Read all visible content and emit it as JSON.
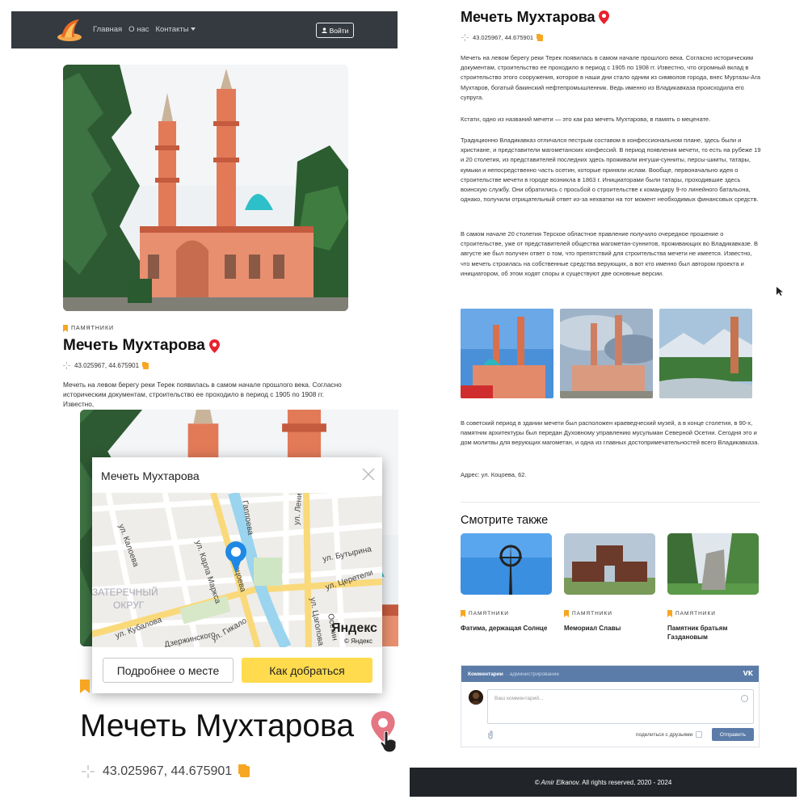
{
  "nav": {
    "links": [
      "Главная",
      "О нас",
      "Контакты"
    ],
    "login": "Войти"
  },
  "tag": "ПАМЯТНИКИ",
  "title": "Мечеть Мухтарова",
  "coords": "43.025967, 44.675901",
  "intro_short": "Мечеть на левом берегу реки Терек появилась в самом начале прошлого века. Согласно историческим документам, строительство ее проходило в период с 1905 по 1908 гг. Известно,",
  "popup": {
    "title": "Мечеть Мухтарова",
    "more": "Подробнее о месте",
    "route": "Как добраться",
    "streets": [
      "ул. Ленина",
      "Гаппоева",
      "ул. Коцоева",
      "ул. Карла Маркса",
      "ул. Калоева",
      "ул. Бутырина",
      "ул. Церетели",
      "ЗАТЕРЕЧНЫЙ",
      "ОКРУГ",
      "ул. Кубалова",
      "Дзержинского",
      "ул. Гикало",
      "ул. Цаголова",
      "Осетин"
    ],
    "brand": "Яндекс",
    "brand_small": "© Яндекс"
  },
  "article": {
    "paragraphs": [
      "Мечеть на левом берегу реки Терек появилась в самом начале прошлого века. Согласно историческим документам, строительство ее проходило в период с 1905 по 1908 гг. Известно, что огромный вклад в строительство этого сооружения, которое в наши дни стало одним из символов города, внес Муртазы-Ага Мухтаров, богатый бакинский нефтепромышленник. Ведь именно из Владикавказа происходила его супруга.",
      "Кстати, одно из названий мечети — это как раз мечеть Мухтарова, в память о меценате.",
      "Традиционно Владикавказ отличался пестрым составом в конфессиональном плане, здесь были и христиане, и представители магометанских конфессий. В период появления мечети, то есть на рубеже 19 и 20 столетия, из представителей последних здесь проживали ингуши-сунниты, персы-шииты, татары, кумыки и непосредственно часть осетин, которые приняли ислам. Вообще, первоначально идея о строительстве мечети в городе возникла в 1863 г. Инициаторами были татары, проходившие здесь воинскую службу. Они обратились с просьбой о строительстве к командиру 9-го линейного батальона, однако, получили отрицательный ответ из-за нехватки на тот момент необходимых финансовых средств.",
      "В самом начале 20 столетия Терское областное правление получило очередное прошение о строительстве, уже от представителей общества магометан-суннитов, проживающих во Владикавказе. В августе же был получен ответ о том, что препятствий для строительства мечети не имеется. Известно, что мечеть строилась на собственные средства верующих, а вот кто именно был автором проекта и инициатором, об этом ходят споры и существуют две основные версии.",
      "В советский период в здании мечети был расположен краеведческий музей, а в конце столетия, в 90-х, памятник архитектуры был передан Духовному управлению мусульман Северной Осетии. Сегодня это и дом молитвы для верующих магометан, и одна из главных достопримечательностей всего Владикавказа."
    ],
    "address": "Адрес: ул. Коцоева, 62."
  },
  "see_also": {
    "heading": "Смотрите также",
    "cards": [
      {
        "tag": "ПАМЯТНИКИ",
        "name": "Фатима, держащая Солнце"
      },
      {
        "tag": "ПАМЯТНИКИ",
        "name": "Мемориал Славы"
      },
      {
        "tag": "ПАМЯТНИКИ",
        "name": "Памятник братьям Газдановым"
      }
    ]
  },
  "comments": {
    "header": "Комментарии",
    "header_sub": "· администрирование",
    "placeholder": "Ваш комментарий...",
    "share": "поделиться с друзьями",
    "send": "Отправить",
    "vk": "VK"
  },
  "footer": {
    "author": "© Amir Elkanov.",
    "rights": " All rights reserved, 2020 - 2024"
  },
  "colors": {
    "navbar": "#343a40",
    "accent": "#f7a621",
    "pin": "#e8212e",
    "route_button": "#ffdb4d",
    "vk_blue": "#5b7ca8",
    "footer": "#212529"
  }
}
